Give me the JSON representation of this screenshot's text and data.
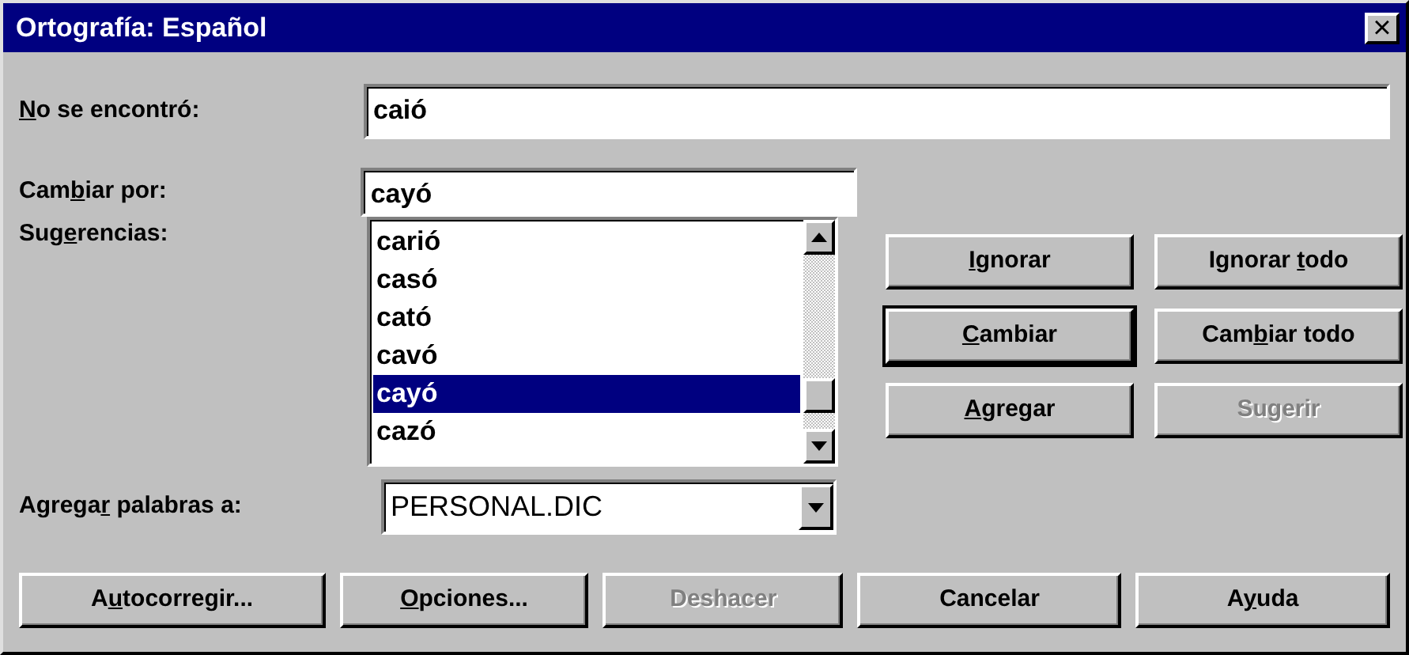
{
  "window": {
    "title": "Ortografía: Español",
    "close": "×"
  },
  "not_found": {
    "label": {
      "key": "N",
      "after": "o se encontró:"
    },
    "value": "caió"
  },
  "change_to": {
    "label": {
      "before": "Cam",
      "key": "b",
      "after": "iar por:"
    },
    "value": "cayó"
  },
  "suggestions": {
    "label": {
      "before": "Sug",
      "key": "e",
      "after": "rencias:"
    },
    "items": [
      {
        "text": "carió",
        "selected": false
      },
      {
        "text": "casó",
        "selected": false
      },
      {
        "text": "cató",
        "selected": false
      },
      {
        "text": "cavó",
        "selected": false
      },
      {
        "text": "cayó",
        "selected": true
      },
      {
        "text": "cazó",
        "selected": false
      }
    ]
  },
  "add_words_to": {
    "label": {
      "before": "Agrega",
      "key": "r",
      "after": " palabras a:"
    },
    "value": "PERSONAL.DIC"
  },
  "side_buttons": [
    {
      "label": {
        "key": "I",
        "after": "gnorar"
      },
      "disabled": false,
      "default": false
    },
    {
      "label": {
        "before": "Ignorar ",
        "key": "t",
        "after": "odo"
      },
      "disabled": false,
      "default": false
    },
    {
      "label": {
        "key": "C",
        "after": "ambiar"
      },
      "disabled": false,
      "default": true
    },
    {
      "label": {
        "before": "Cam",
        "key": "b",
        "after": "iar todo"
      },
      "disabled": false,
      "default": false
    },
    {
      "label": {
        "key": "A",
        "after": "gregar"
      },
      "disabled": false,
      "default": false
    },
    {
      "label": {
        "before": "Sugerir"
      },
      "disabled": true,
      "default": false
    }
  ],
  "bottom_buttons": [
    {
      "label": {
        "before": "A",
        "key": "u",
        "after": "tocorregir..."
      },
      "disabled": false
    },
    {
      "label": {
        "key": "O",
        "after": "pciones..."
      },
      "disabled": false
    },
    {
      "label": {
        "before": "Deshacer"
      },
      "disabled": true
    },
    {
      "label": {
        "before": "Cancelar"
      },
      "disabled": false
    },
    {
      "label": {
        "before": "A",
        "key": "y",
        "after": "uda"
      },
      "disabled": false
    }
  ]
}
